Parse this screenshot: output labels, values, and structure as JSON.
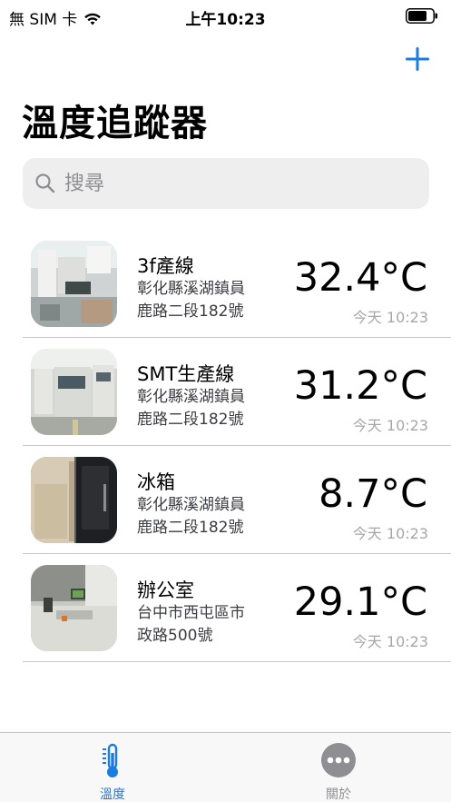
{
  "status_bar": {
    "carrier": "無 SIM 卡",
    "time": "上午10:23",
    "icons": [
      "wifi-icon",
      "battery-icon"
    ]
  },
  "header": {
    "add_icon": "plus-icon",
    "title": "溫度追蹤器"
  },
  "search": {
    "placeholder": "搜尋",
    "value": "",
    "icon": "search-icon"
  },
  "devices": [
    {
      "name": "3f產線",
      "address_line1": "彰化縣溪湖鎮員",
      "address_line2": "鹿路二段182號",
      "temperature": "32.4°C",
      "updated": "今天 10:23",
      "photo": "factory-line-photo"
    },
    {
      "name": "SMT生產線",
      "address_line1": "彰化縣溪湖鎮員",
      "address_line2": "鹿路二段182號",
      "temperature": "31.2°C",
      "updated": "今天 10:23",
      "photo": "smt-machine-photo"
    },
    {
      "name": "冰箱",
      "address_line1": "彰化縣溪湖鎮員",
      "address_line2": "鹿路二段182號",
      "temperature": "8.7°C",
      "updated": "今天 10:23",
      "photo": "fridge-photo"
    },
    {
      "name": "辦公室",
      "address_line1": "台中市西屯區市",
      "address_line2": "政路500號",
      "temperature": "29.1°C",
      "updated": "今天 10:23",
      "photo": "office-photo"
    }
  ],
  "tab_bar": {
    "tabs": [
      {
        "label": "溫度",
        "icon": "thermometer-icon",
        "selected": true
      },
      {
        "label": "關於",
        "icon": "more-icon",
        "selected": false
      }
    ]
  },
  "colors": {
    "accent": "#1c7be0",
    "secondary_text": "#a6a6ab",
    "search_bg": "#eeeeef"
  }
}
